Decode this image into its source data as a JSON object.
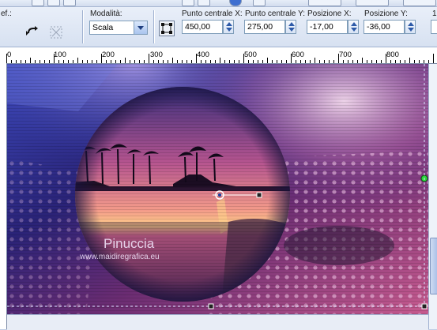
{
  "toolbar": {
    "left_partial_label": "ef.:",
    "mode": {
      "label": "Modalità:",
      "value": "Scala"
    },
    "center_x": {
      "label": "Punto centrale X:",
      "value": "450,00"
    },
    "center_y": {
      "label": "Punto centrale Y:",
      "value": "275,00"
    },
    "pos_x": {
      "label": "Posizione X:",
      "value": "-17,00"
    },
    "pos_y": {
      "label": "Posizione Y:",
      "value": "-36,00"
    },
    "right_partial_label": "1"
  },
  "ruler": {
    "labels": [
      "0",
      "100",
      "200",
      "300",
      "400",
      "500",
      "600",
      "700",
      "800"
    ]
  },
  "canvas": {
    "watermark_name": "Pinuccia",
    "watermark_url": "www.maidiregrafica.eu"
  },
  "colors": {
    "toolbar_bg": "#dfe7f4",
    "accent_blue": "#2d5aa8",
    "canvas_dark": "#2a1f6b",
    "sunset_pink": "#e86aa0"
  }
}
